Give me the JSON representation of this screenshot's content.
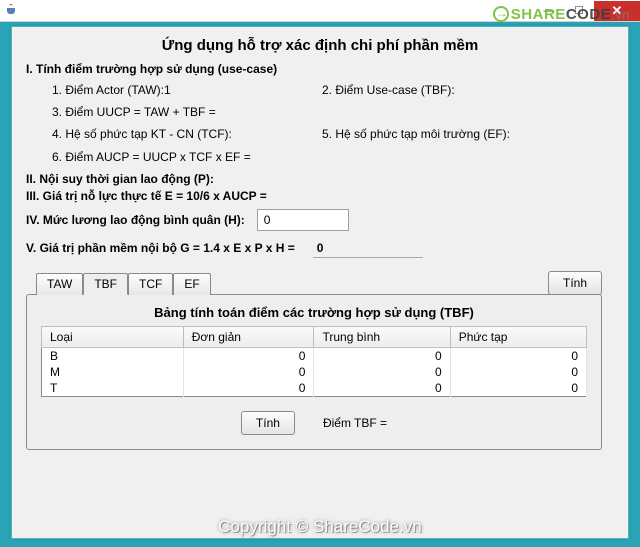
{
  "window": {
    "title": "Ứng dụng hỗ trợ xác định chi phí phần mềm"
  },
  "section1": {
    "heading": "I. Tính điểm trường hợp sử dụng (use-case)",
    "item1": "1. Điểm Actor (TAW):1",
    "item2": "2. Điểm Use-case (TBF):",
    "item3": "3. Điểm UUCP = TAW + TBF =",
    "item4": "4. Hệ số phức tạp KT - CN (TCF):",
    "item5": "5. Hệ số phức tạp môi trường (EF):",
    "item6": "6. Điểm AUCP = UUCP x TCF x EF ="
  },
  "section2": {
    "heading": "II. Nội suy thời gian lao động (P):"
  },
  "section3": {
    "heading": "III. Giá trị nỗ lực thực tế E = 10/6 x AUCP ="
  },
  "section4": {
    "label": "IV. Mức lương lao động bình quân (H):",
    "value": "0"
  },
  "section5": {
    "label": "V. Giá trị phần mềm nội bộ G = 1.4 x E x P x H =",
    "value": "0"
  },
  "buttons": {
    "tinh": "Tính"
  },
  "tabs": {
    "items": [
      "TAW",
      "TBF",
      "TCF",
      "EF"
    ],
    "active": 1
  },
  "tbf": {
    "title": "Bảng tính toán điểm các trường hợp sử dụng (TBF)",
    "columns": [
      "Loại",
      "Đơn giản",
      "Trung bình",
      "Phức tạp"
    ],
    "rows": [
      {
        "loai": "B",
        "dg": "0",
        "tb": "0",
        "pt": "0"
      },
      {
        "loai": "M",
        "dg": "0",
        "tb": "0",
        "pt": "0"
      },
      {
        "loai": "T",
        "dg": "0",
        "tb": "0",
        "pt": "0"
      }
    ],
    "footer_label": "Điểm TBF ="
  },
  "watermark": {
    "logo_share": "SHARE",
    "logo_code": "CODE",
    "logo_domain": ".vn",
    "copyright": "Copyright © ShareCode.vn"
  }
}
